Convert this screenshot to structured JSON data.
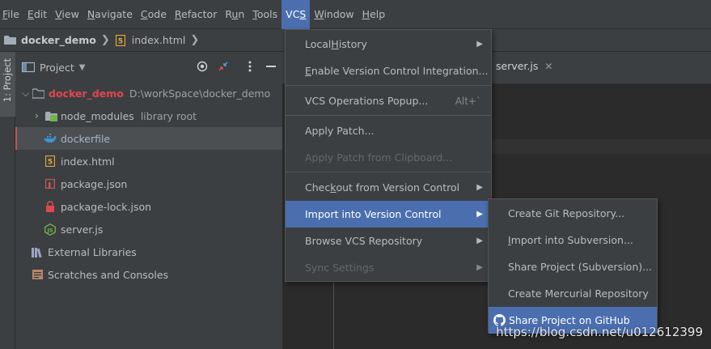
{
  "menubar": {
    "items": [
      {
        "pre": "",
        "m": "F",
        "post": "ile"
      },
      {
        "pre": "",
        "m": "E",
        "post": "dit"
      },
      {
        "pre": "",
        "m": "V",
        "post": "iew"
      },
      {
        "pre": "",
        "m": "N",
        "post": "avigate"
      },
      {
        "pre": "",
        "m": "C",
        "post": "ode"
      },
      {
        "pre": "",
        "m": "R",
        "post": "efactor"
      },
      {
        "pre": "R",
        "m": "u",
        "post": "n"
      },
      {
        "pre": "",
        "m": "T",
        "post": "ools"
      },
      {
        "pre": "VC",
        "m": "S",
        "post": ""
      },
      {
        "pre": "",
        "m": "W",
        "post": "indow"
      },
      {
        "pre": "",
        "m": "H",
        "post": "elp"
      }
    ]
  },
  "breadcrumb": {
    "project": "docker_demo",
    "file": "index.html"
  },
  "side_stripe": {
    "label": "1: Project"
  },
  "project_panel": {
    "title": "Project",
    "tree": [
      {
        "label": "docker_demo",
        "hint": "D:\\workSpace\\docker_demo"
      },
      {
        "label": "node_modules",
        "hint": "library root"
      },
      {
        "label": "dockerfile"
      },
      {
        "label": "index.html"
      },
      {
        "label": "package.json"
      },
      {
        "label": "package-lock.json"
      },
      {
        "label": "server.js"
      },
      {
        "label": "External Libraries"
      },
      {
        "label": "Scratches and Consoles"
      }
    ]
  },
  "editor": {
    "tab_label": "server.js"
  },
  "vcs_menu": {
    "items": [
      {
        "pre": "Local ",
        "m": "H",
        "post": "istory",
        "submenu": true
      },
      {
        "pre": "",
        "m": "E",
        "post": "nable Version Control Integration..."
      },
      {
        "pre": "VCS Operations Popup...",
        "m": "",
        "post": "",
        "shortcut": "Alt+`"
      },
      {
        "pre": "Apply Patch...",
        "m": "",
        "post": ""
      },
      {
        "pre": "Apply Patch from Clipboard...",
        "m": "",
        "post": "",
        "disabled": true
      },
      {
        "pre": "Chec",
        "m": "k",
        "post": "out from Version Control",
        "submenu": true
      },
      {
        "pre": "Import into Version Control",
        "m": "",
        "post": "",
        "submenu": true
      },
      {
        "pre": "Browse VCS Repository",
        "m": "",
        "post": "",
        "submenu": true
      },
      {
        "pre": "Sync Settings",
        "m": "",
        "post": "",
        "submenu": true,
        "disabled": true
      }
    ]
  },
  "submenu": {
    "items": [
      {
        "pre": "Create Git Repository...",
        "m": "",
        "post": ""
      },
      {
        "pre": "",
        "m": "I",
        "post": "mport into Subversion..."
      },
      {
        "pre": "Share Project (Subversion)...",
        "m": "",
        "post": ""
      },
      {
        "pre": "Create Mercurial Repository",
        "m": "",
        "post": ""
      },
      {
        "pre": "Share Project on GitHub",
        "m": "",
        "post": ""
      }
    ]
  },
  "watermark": "https://blog.csdn.net/u012612399",
  "colors": {
    "accent": "#4b6eaf",
    "project_root": "#e0474f",
    "panel_bg": "#3c3f41",
    "editor_bg": "#2b2b2b"
  }
}
